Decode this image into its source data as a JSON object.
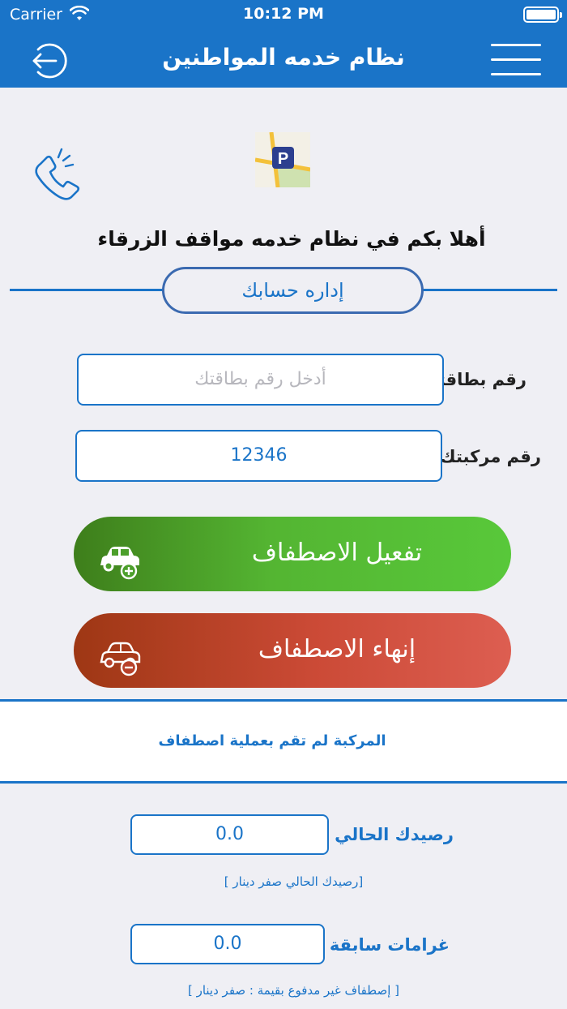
{
  "status_bar": {
    "carrier": "Carrier",
    "time": "10:12 PM"
  },
  "nav": {
    "title": "نظام خدمه المواطنين"
  },
  "welcome": "أهلا بكم في نظام خدمه مواقف الزرقاء",
  "account_section": {
    "label": "إداره حسابك"
  },
  "card_field": {
    "label": "رقم بطاقتك :",
    "value": "",
    "placeholder": "أدخل رقم بطاقتك"
  },
  "vehicle_field": {
    "label": "رقم مركبتك :",
    "value": "12346"
  },
  "buttons": {
    "activate": "تفعيل الاصطفاف",
    "end": "إنهاء الاصطفاف"
  },
  "status_message": "المركبة لم تقم بعملية اصطفاف",
  "balance": {
    "label": "رصيدك الحالي :",
    "value": "0.0",
    "note": "[رصيدك الحالي صفر دينار ]"
  },
  "fines": {
    "label": "غرامات سابقة :",
    "value": "0.0",
    "note": "[ إصطفاف غير مدفوع بقيمة : صفر دينار ]"
  },
  "icons": {
    "back": "arrow-left-circle-icon",
    "menu": "hamburger-menu-icon",
    "phone": "phone-ringing-icon",
    "logo": "parking-logo",
    "car_add": "car-plus-icon",
    "car_remove": "car-minus-icon"
  },
  "colors": {
    "primary": "#1a74c8",
    "activate_start": "#3e7e1b",
    "activate_end": "#58c83a",
    "end_start": "#9e3714",
    "end_end": "#dd5e51",
    "background": "#efeff4"
  }
}
